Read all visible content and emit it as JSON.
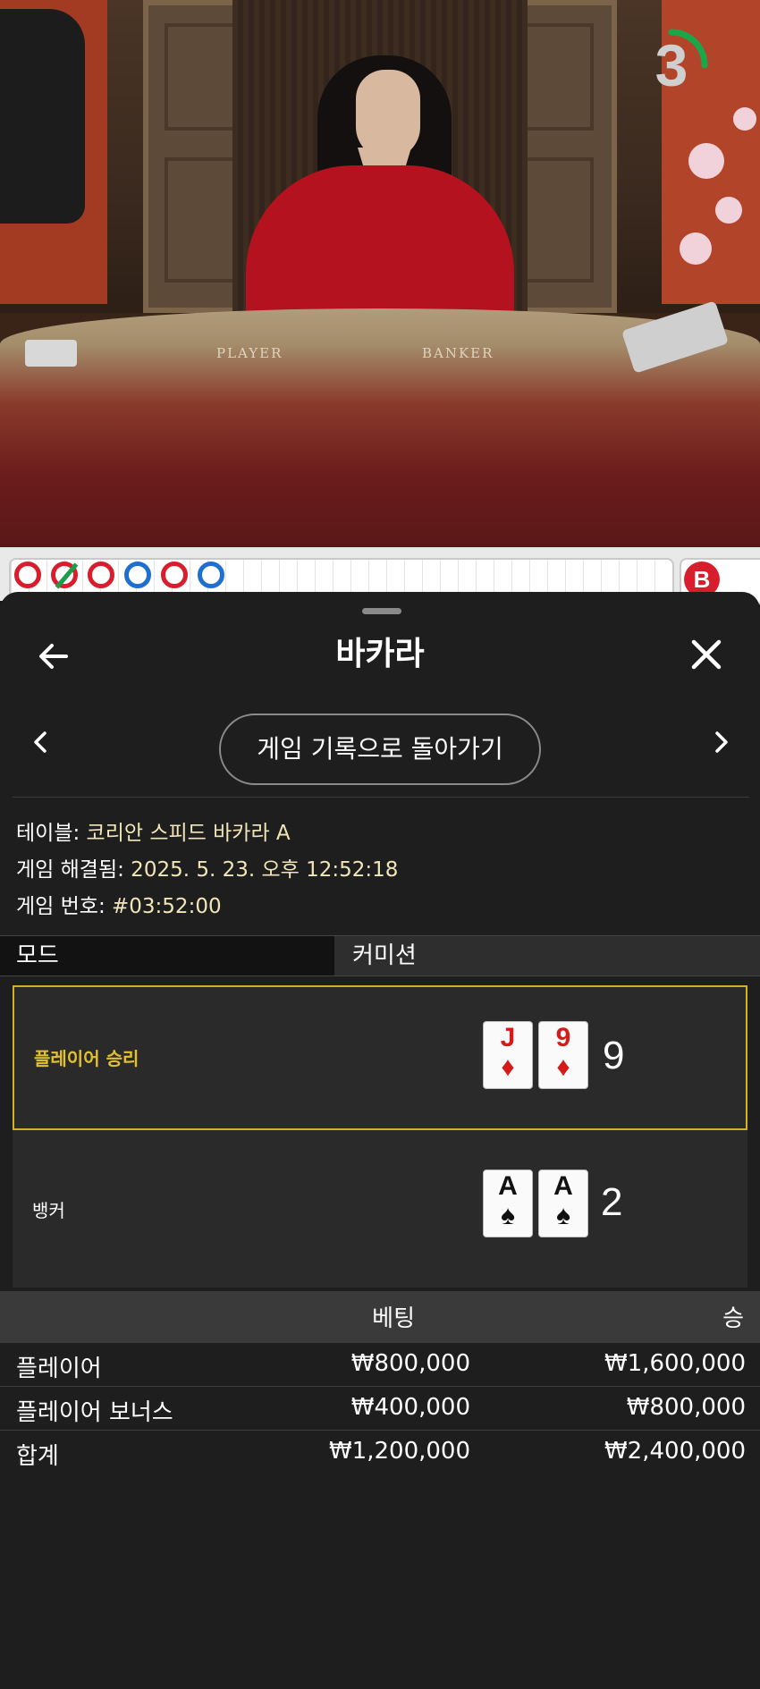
{
  "video": {
    "felt_player_label": "PLAYER",
    "felt_banker_label": "BANKER",
    "countdown": "3",
    "countdown_ring_color": "#18a84a"
  },
  "road": {
    "results": [
      "B",
      "B",
      "B",
      "P",
      "B",
      "P"
    ],
    "tie_marker_index": 1,
    "side_label": "B"
  },
  "modal": {
    "title": "바카라",
    "return_button_label": "게임 기록으로 돌아가기",
    "info": {
      "table_label": "테이블:",
      "table_value": " 코리안 스피드 바카라 A",
      "resolved_label": "게임 해결됨:",
      "resolved_value": " 2025. 5. 23. 오후 12:52:18",
      "game_no_label": "게임 번호:",
      "game_no_value": " #03:52:00"
    },
    "mode": {
      "label": "모드",
      "value": "커미션"
    },
    "outcomes": {
      "player": {
        "label": "플레이어 승리",
        "cards": [
          {
            "rank": "J",
            "suit": "♦",
            "color": "red"
          },
          {
            "rank": "9",
            "suit": "♦",
            "color": "red"
          }
        ],
        "score": "9",
        "highlight_color": "#d4b21e"
      },
      "banker": {
        "label": "뱅커",
        "cards": [
          {
            "rank": "A",
            "suit": "♠",
            "color": "black"
          },
          {
            "rank": "A",
            "suit": "♠",
            "color": "black"
          }
        ],
        "score": "2"
      }
    },
    "bets": {
      "headers": {
        "bet": "베팅",
        "win": "승"
      },
      "rows": [
        {
          "name": "플레이어",
          "bet": "₩800,000",
          "win": "₩1,600,000"
        },
        {
          "name": "플레이어 보너스",
          "bet": "₩400,000",
          "win": "₩800,000"
        },
        {
          "name": "합계",
          "bet": "₩1,200,000",
          "win": "₩2,400,000"
        }
      ]
    }
  }
}
